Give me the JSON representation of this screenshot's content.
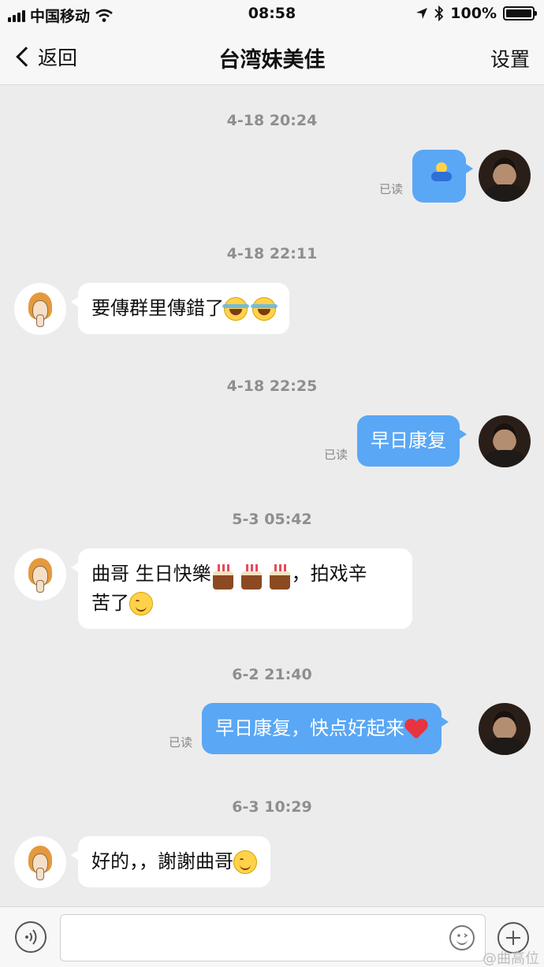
{
  "status_bar": {
    "carrier": "中国移动",
    "time": "08:58",
    "battery": "100%"
  },
  "nav": {
    "back_label": "返回",
    "title": "台湾妹美佳",
    "settings_label": "设置"
  },
  "messages": [
    {
      "timestamp": "4-18 20:24",
      "side": "out",
      "type": "sticker",
      "status": "已读"
    },
    {
      "timestamp": "4-18 22:11",
      "side": "in",
      "text": "要傳群里傳錯了"
    },
    {
      "timestamp": "4-18 22:25",
      "side": "out",
      "text": "早日康复",
      "status": "已读"
    },
    {
      "timestamp": "5-3 05:42",
      "side": "in",
      "line1_a": "曲哥  生日快樂",
      "line1_b": "，拍戏辛",
      "line2": "苦了"
    },
    {
      "timestamp": "6-2 21:40",
      "side": "out",
      "text": "早日康复，快点好起来",
      "status": "已读"
    },
    {
      "timestamp": "6-3 10:29",
      "side": "in",
      "text": "好的，，謝謝曲哥"
    }
  ],
  "input": {
    "placeholder": ""
  },
  "watermark": "@曲高位",
  "colors": {
    "outgoing_bubble": "#5aa7f5",
    "incoming_bubble": "#ffffff",
    "background": "#ececec"
  }
}
